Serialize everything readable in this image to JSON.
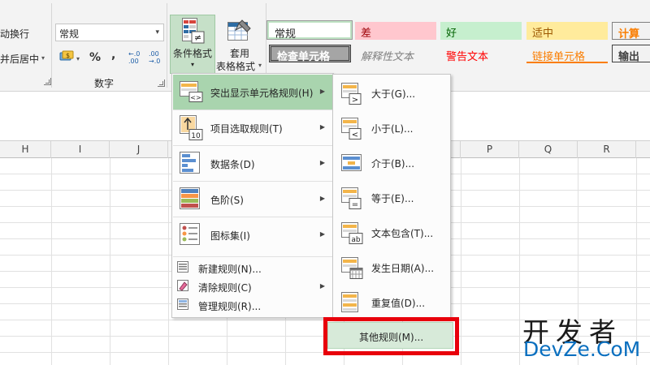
{
  "ribbon": {
    "wrap_text": "动换行",
    "merge_center": "并后居中",
    "merge_arrow": "▾",
    "alignment_launcher": "",
    "number_format_value": "常规",
    "number_group_label": "数字",
    "currency_symbol": "$",
    "percent_symbol": "%",
    "comma_symbol": ",",
    "increase_decimal": "←.0 .00",
    "decrease_decimal": ".00 →.0",
    "conditional_format_label": "条件格式",
    "table_format_label1": "套用",
    "table_format_label2": "表格格式",
    "styles": {
      "normal": "常规",
      "bad": "差",
      "good": "好",
      "neutral": "适中",
      "calculation": "计算",
      "check_cell": "检查单元格",
      "explanatory": "解释性文本",
      "warning": "警告文本",
      "linked_cell": "链接单元格",
      "output": "输出"
    }
  },
  "columns": [
    "H",
    "I",
    "J",
    "",
    "",
    "",
    "",
    "",
    "P",
    "Q",
    "R"
  ],
  "main_menu": {
    "items": [
      {
        "label": "突出显示单元格规则(H)",
        "icon": "highlight-cells-icon"
      },
      {
        "label": "项目选取规则(T)",
        "icon": "top-bottom-rules-icon"
      },
      {
        "label": "数据条(D)",
        "icon": "data-bars-icon"
      },
      {
        "label": "色阶(S)",
        "icon": "color-scales-icon"
      },
      {
        "label": "图标集(I)",
        "icon": "icon-sets-icon"
      }
    ],
    "small_items": [
      {
        "label": "新建规则(N)...",
        "icon": "new-rule-icon"
      },
      {
        "label": "清除规则(C)",
        "icon": "clear-rules-icon"
      },
      {
        "label": "管理规则(R)...",
        "icon": "manage-rules-icon"
      }
    ]
  },
  "sub_menu": {
    "items": [
      {
        "label": "大于(G)...",
        "symbol": ">"
      },
      {
        "label": "小于(L)...",
        "symbol": "<"
      },
      {
        "label": "介于(B)...",
        "symbol": ""
      },
      {
        "label": "等于(E)...",
        "symbol": "="
      },
      {
        "label": "文本包含(T)...",
        "symbol": "ab"
      },
      {
        "label": "发生日期(A)...",
        "symbol": ""
      },
      {
        "label": "重复值(D)...",
        "symbol": ""
      }
    ],
    "more_rules": "其他规则(M)..."
  },
  "watermark": {
    "top": "开发者",
    "bottom": "DevZe.CoM"
  },
  "colors": {
    "menu_highlight": "#a9d4ae",
    "red_box": "#e8000b",
    "style_bad_bg": "#ffc7ce",
    "style_good_bg": "#c6efce",
    "style_neutral_bg": "#ffeb9c",
    "style_calc_bg": "#f2f2f2"
  }
}
